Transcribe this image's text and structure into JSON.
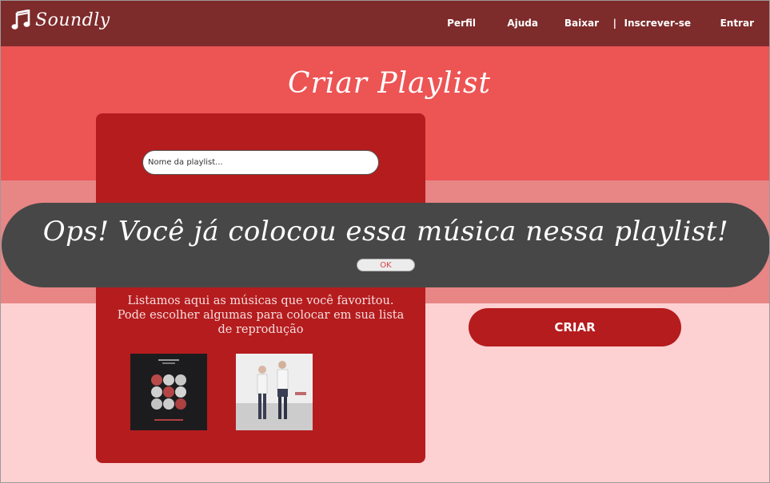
{
  "header": {
    "brand": "Soundly",
    "nav": {
      "perfil": "Perfil",
      "ajuda": "Ajuda",
      "baixar": "Baixar",
      "separator": "|",
      "inscrever": "Inscrever-se",
      "entrar": "Entrar"
    }
  },
  "page": {
    "title": "Criar Playlist"
  },
  "form": {
    "playlist_name_placeholder": "Nome da playlist...",
    "favorites_text": "Listamos aqui as músicas que você favoritou. Pode escolher algumas para colocar em sua lista de reprodução",
    "create_label": "CRIAR"
  },
  "alert": {
    "message": "Ops! Você já colocou essa música nessa playlist!",
    "ok_label": "OK"
  },
  "icons": {
    "logo": "music-note-icon"
  },
  "colors": {
    "header": "#7e2b2b",
    "accent": "#b51c1e",
    "band_top": "#ed5454",
    "alert_bg": "#474747"
  }
}
